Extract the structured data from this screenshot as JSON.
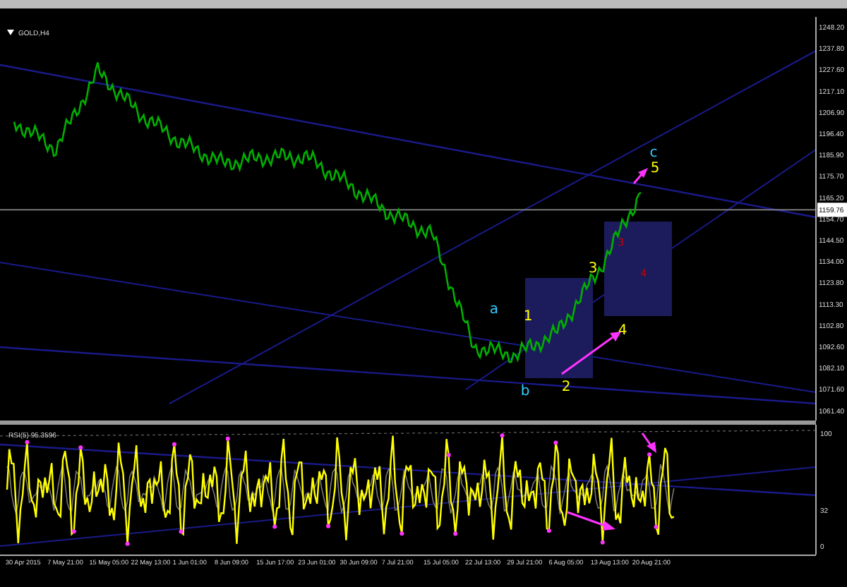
{
  "chart": {
    "title": "GOLD,H4",
    "current_price": "1159.76",
    "price_axis": [
      "1248.20",
      "1237.80",
      "1227.60",
      "1217.10",
      "1206.90",
      "1196.40",
      "1185.90",
      "1175.70",
      "1165.20",
      "1154.70",
      "1144.50",
      "1134.00",
      "1123.80",
      "1113.30",
      "1102.80",
      "1092.60",
      "1082.10",
      "1071.60",
      "1061.40"
    ],
    "wave_labels": [
      {
        "text": "a",
        "color": "#33ccff"
      },
      {
        "text": "b",
        "color": "#33ccff"
      },
      {
        "text": "c",
        "color": "#33ccff"
      },
      {
        "text": "1",
        "color": "#ffff00"
      },
      {
        "text": "2",
        "color": "#ffff00"
      },
      {
        "text": "3",
        "color": "#ffff00"
      },
      {
        "text": "4",
        "color": "#ffff00"
      },
      {
        "text": "5",
        "color": "#ffff00"
      },
      {
        "text": "3",
        "color": "#cc0000"
      },
      {
        "text": "4",
        "color": "#cc0000"
      }
    ]
  },
  "rsi": {
    "title": "RSI(5) 95.3596",
    "ticks": [
      "100",
      "32",
      "0"
    ]
  },
  "time_axis": [
    "30 Apr 2015",
    "7 May 21:00",
    "15 May 05:00",
    "22 May 13:00",
    "1 Jun 01:00",
    "8 Jun 09:00",
    "15 Jun 17:00",
    "23 Jun 01:00",
    "30 Jun 09:00",
    "7 Jul 21:00",
    "15 Jul 05:00",
    "22 Jul 13:00",
    "29 Jul 21:00",
    "6 Aug 05:00",
    "13 Aug 13:00",
    "20 Aug 21:00"
  ]
}
